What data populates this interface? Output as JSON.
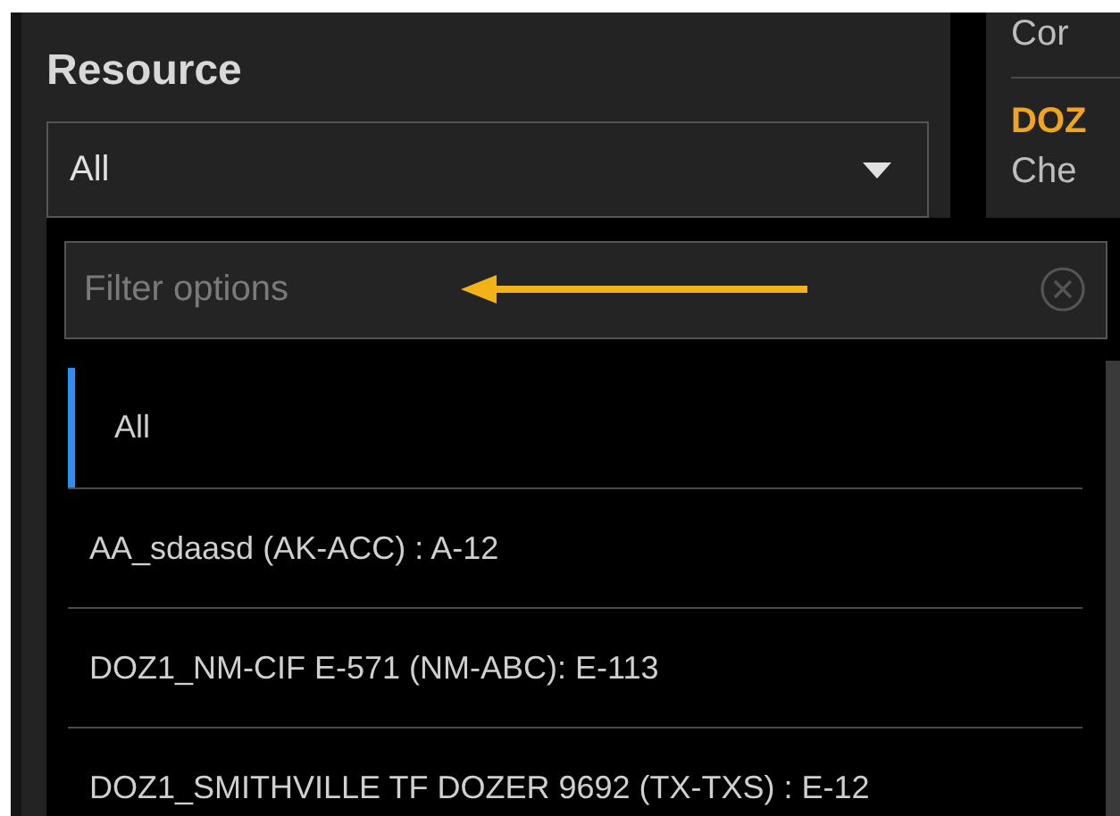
{
  "panel": {
    "title": "Resource",
    "select": {
      "value": "All",
      "expanded": true
    }
  },
  "side_panel": {
    "lines": [
      {
        "text": "Cor",
        "kind": "plain"
      },
      {
        "text": "DOZ",
        "kind": "highlight"
      },
      {
        "text": "Che",
        "kind": "plain"
      }
    ]
  },
  "dropdown": {
    "filter": {
      "placeholder": "Filter options"
    },
    "options": [
      {
        "label": "All",
        "selected": true
      },
      {
        "label": "AA_sdaasd (AK-ACC) : A-12",
        "selected": false
      },
      {
        "label": "DOZ1_NM-CIF E-571 (NM-ABC): E-113",
        "selected": false
      },
      {
        "label": "DOZ1_SMITHVILLE TF DOZER 9692 (TX-TXS) : E-12",
        "selected": false
      }
    ]
  }
}
